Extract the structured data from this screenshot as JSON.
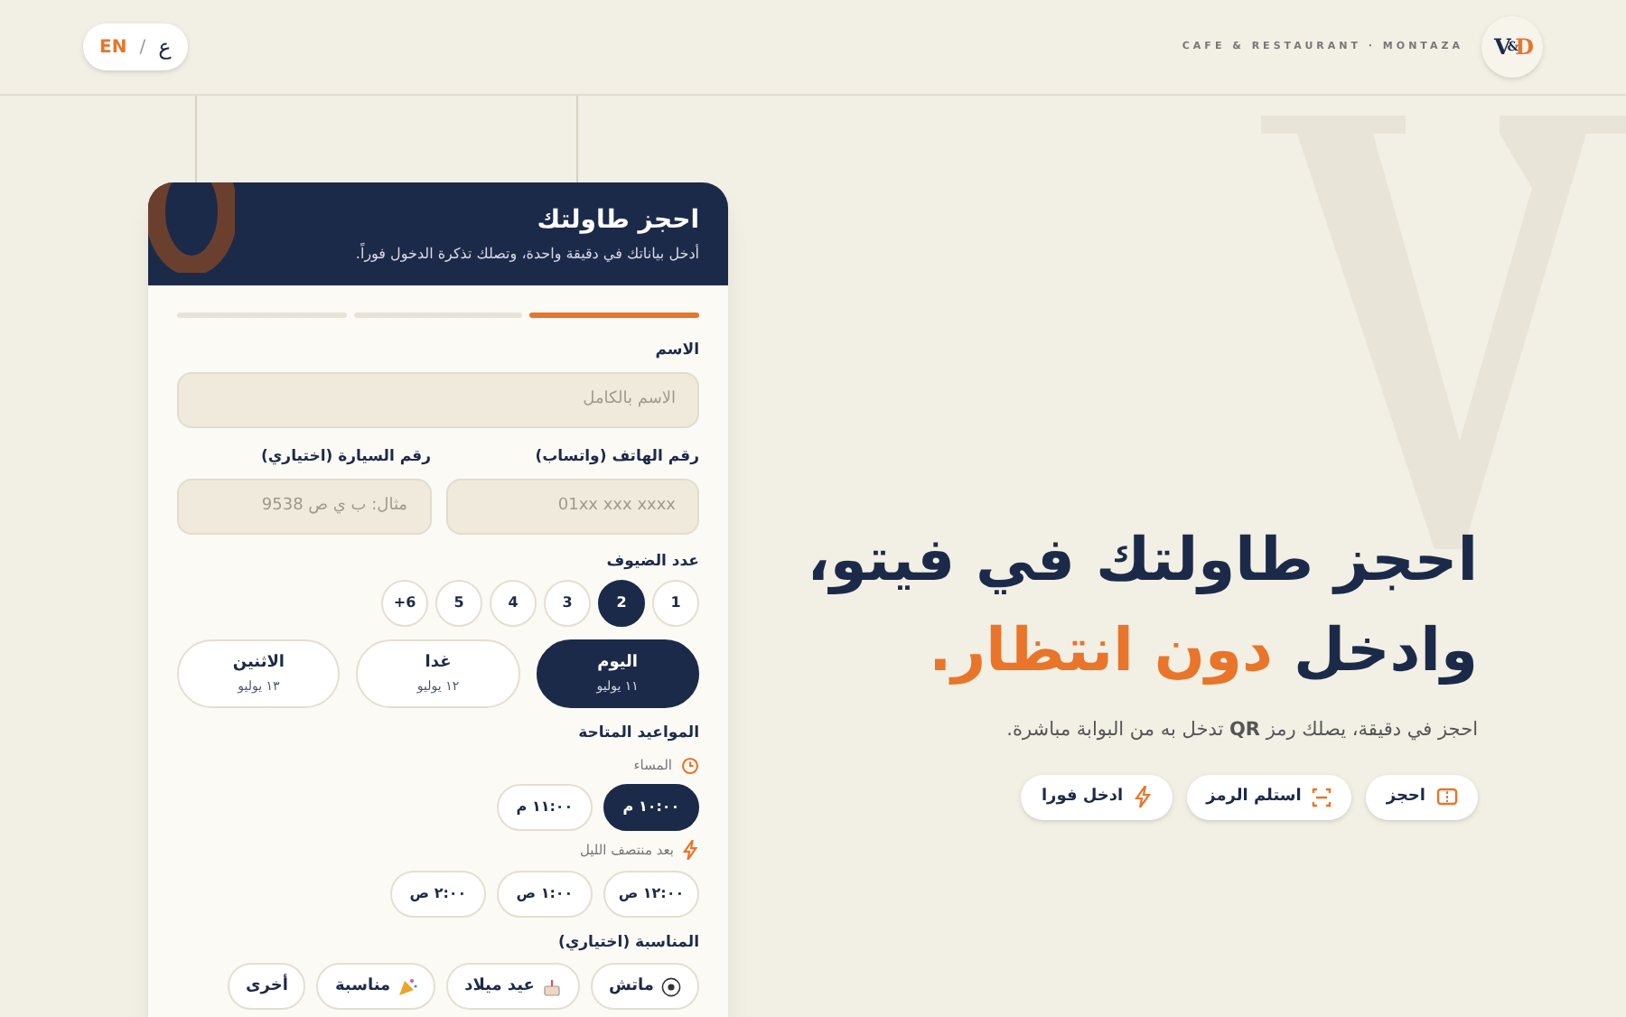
{
  "header": {
    "language": {
      "current": "EN",
      "separator": "/",
      "other": "ع"
    },
    "tagline": "CAFE & RESTAURANT · MONTAZA",
    "logo": {
      "first": "V",
      "second": "&",
      "third": "D"
    }
  },
  "card": {
    "title": "احجز طاولتك",
    "subtitle": "أدخل بياناتك في دقيقة واحدة، وتصلك تذكرة الدخول فوراً.",
    "steps": [
      {
        "selected": true
      },
      {
        "selected": false
      },
      {
        "selected": false
      }
    ],
    "name_field": {
      "label": "الاسم",
      "placeholder": "الاسم بالكامل"
    },
    "phone_field": {
      "label": "رقم الهاتف (واتساب)",
      "placeholder": "01xx xxx xxxx"
    },
    "car_field": {
      "label": "رقم السيارة (اختياري)",
      "placeholder": "مثال: ب ي ص 9538"
    },
    "guests": {
      "label": "عدد الضيوف",
      "options": [
        {
          "label": "1",
          "selected": false
        },
        {
          "label": "2",
          "selected": true
        },
        {
          "label": "3",
          "selected": false
        },
        {
          "label": "4",
          "selected": false
        },
        {
          "label": "5",
          "selected": false
        },
        {
          "label": "6+",
          "selected": false
        }
      ]
    },
    "days": [
      {
        "label": "اليوم",
        "date": "١١ يوليو",
        "selected": true
      },
      {
        "label": "غدا",
        "date": "١٢ يوليو",
        "selected": false
      },
      {
        "label": "الاثنين",
        "date": "١٣ يوليو",
        "selected": false
      }
    ],
    "slots_title": "المواعيد المتاحة",
    "slot_groups": [
      {
        "kind": "evening",
        "label": "المساء",
        "slots": [
          {
            "label": "١٠:٠٠ م",
            "selected": true
          },
          {
            "label": "١١:٠٠ م",
            "selected": false
          }
        ]
      },
      {
        "kind": "night",
        "label": "بعد منتصف الليل",
        "slots": [
          {
            "label": "١٢:٠٠ ص",
            "selected": false
          },
          {
            "label": "١:٠٠ ص",
            "selected": false
          },
          {
            "label": "٢:٠٠ ص",
            "selected": false
          }
        ]
      }
    ],
    "occasion": {
      "label": "المناسبة (اختياري)",
      "options": [
        {
          "kind": "ball",
          "label": "ماتش"
        },
        {
          "kind": "cake",
          "label": "عيد ميلاد"
        },
        {
          "kind": "party",
          "label": "مناسبة"
        },
        {
          "kind": "none",
          "label": "أخرى"
        }
      ]
    }
  },
  "hero": {
    "line1": "احجز طاولتك في فيتو،",
    "line2_start": "وادخل",
    "line2_accent": "دون انتظار.",
    "subtitle": "احجز في دقيقة، يصلك رمز **QR** تدخل به من البوابة مباشرة.",
    "actions": [
      {
        "kind": "ticket",
        "label": "احجز"
      },
      {
        "kind": "scan",
        "label": "استلم الرمز"
      },
      {
        "kind": "bolt",
        "label": "ادخل فورا"
      }
    ]
  }
}
